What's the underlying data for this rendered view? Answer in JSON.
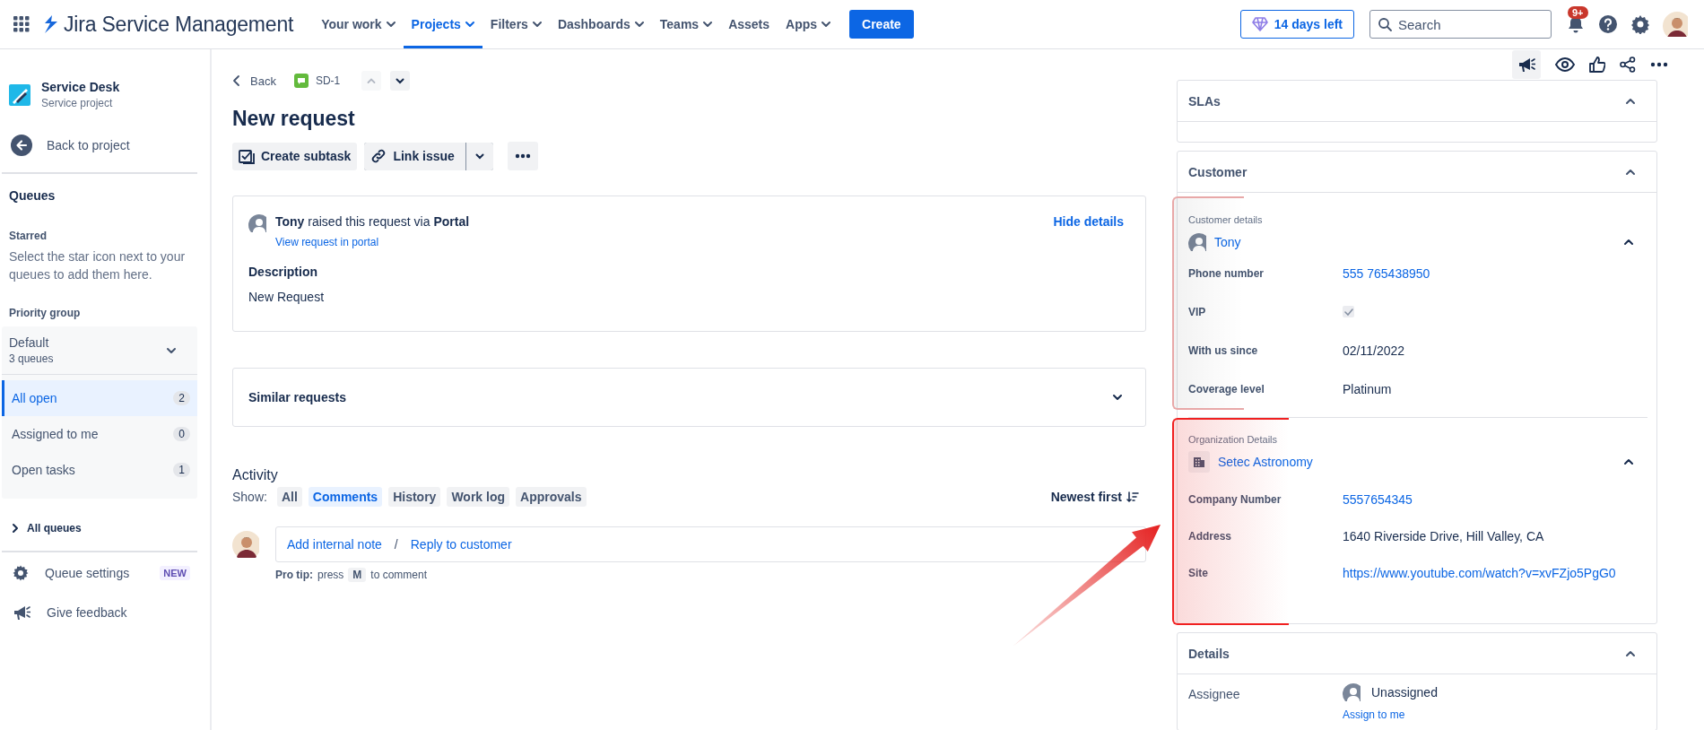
{
  "topbar": {
    "app_name": "Jira Service Management",
    "nav": [
      {
        "label": "Your work",
        "dropdown": true,
        "selected": false
      },
      {
        "label": "Projects",
        "dropdown": true,
        "selected": true
      },
      {
        "label": "Filters",
        "dropdown": true,
        "selected": false
      },
      {
        "label": "Dashboards",
        "dropdown": true,
        "selected": false
      },
      {
        "label": "Teams",
        "dropdown": true,
        "selected": false
      },
      {
        "label": "Assets",
        "dropdown": false,
        "selected": false
      },
      {
        "label": "Apps",
        "dropdown": true,
        "selected": false
      }
    ],
    "create": "Create",
    "trial": "14 days left",
    "search": {
      "placeholder": "Search"
    },
    "notifications_badge": "9+"
  },
  "sidebar": {
    "project_name": "Service Desk",
    "project_type": "Service project",
    "back": "Back to project",
    "section_title": "Queues",
    "starred_title": "Starred",
    "starred_hint": "Select the star icon next to your queues to add them here.",
    "priority_title": "Priority group",
    "group": {
      "name": "Default",
      "count": "3 queues",
      "expanded": true
    },
    "queues": [
      {
        "label": "All open",
        "count": "2",
        "selected": true
      },
      {
        "label": "Assigned to me",
        "count": "0",
        "selected": false
      },
      {
        "label": "Open tasks",
        "count": "1",
        "selected": false
      }
    ],
    "all_queues": "All queues",
    "footer": [
      {
        "kind": "settings",
        "label": "Queue settings",
        "badge": "NEW"
      },
      {
        "kind": "feedback",
        "label": "Give feedback"
      }
    ]
  },
  "issue": {
    "back": "Back",
    "key": "SD-1",
    "title": "New request",
    "actions": [
      {
        "kind": "subtask",
        "label": "Create subtask"
      },
      {
        "kind": "link",
        "label": "Link issue"
      }
    ],
    "request": {
      "raised": "**Tony** raised this request via **Portal**",
      "portal_link": "View request in portal",
      "hide_details": "Hide details",
      "description_title": "Description",
      "description": "New Request"
    },
    "similar": {
      "title": "Similar requests",
      "expanded": false
    },
    "activity": {
      "title": "Activity",
      "show_label": "Show:",
      "filters": [
        {
          "label": "All",
          "selected": false
        },
        {
          "label": "Comments",
          "selected": true
        },
        {
          "label": "History",
          "selected": false
        },
        {
          "label": "Work log",
          "selected": false
        },
        {
          "label": "Approvals",
          "selected": false
        }
      ],
      "sort": "Newest first",
      "comment": {
        "internal_note": "Add internal note",
        "separator": "/",
        "reply": "Reply to customer"
      },
      "pro_tip": {
        "label": "Pro tip:",
        "before": "press",
        "key": "M",
        "after": "to comment"
      }
    }
  },
  "panel": {
    "sections": [
      {
        "kind": "sla",
        "title": "SLAs",
        "expanded": true
      },
      {
        "kind": "customer",
        "title": "Customer",
        "expanded": true,
        "groups": [
          {
            "kind": "person",
            "label": "Customer details",
            "name": "Tony",
            "expanded": true,
            "color": "#e8a8a8",
            "fields": [
              {
                "label": "Phone number",
                "kind": "link",
                "value": "555 765438950"
              },
              {
                "label": "VIP",
                "kind": "checkbox",
                "checked": true
              },
              {
                "label": "With us since",
                "kind": "text",
                "value": "02/11/2022"
              },
              {
                "label": "Coverage level",
                "kind": "text",
                "value": "Platinum"
              }
            ]
          },
          {
            "kind": "organization",
            "label": "Organization Details",
            "name": "Setec Astronomy",
            "expanded": true,
            "color": "#f02020",
            "fields": [
              {
                "label": "Company Number",
                "kind": "link",
                "value": "5557654345"
              },
              {
                "label": "Address",
                "kind": "text",
                "value": "1640 Riverside Drive, Hill Valley, CA"
              },
              {
                "label": "Site",
                "kind": "link",
                "value": "https://www.youtube.com/watch?v=xvFZjo5PgG0"
              }
            ]
          }
        ]
      },
      {
        "kind": "details",
        "title": "Details",
        "expanded": true,
        "fields": [
          {
            "label": "Assignee",
            "kind": "user",
            "value": "Unassigned",
            "action": "Assign to me"
          }
        ]
      }
    ]
  },
  "annotation": {
    "kind": "arrow"
  }
}
